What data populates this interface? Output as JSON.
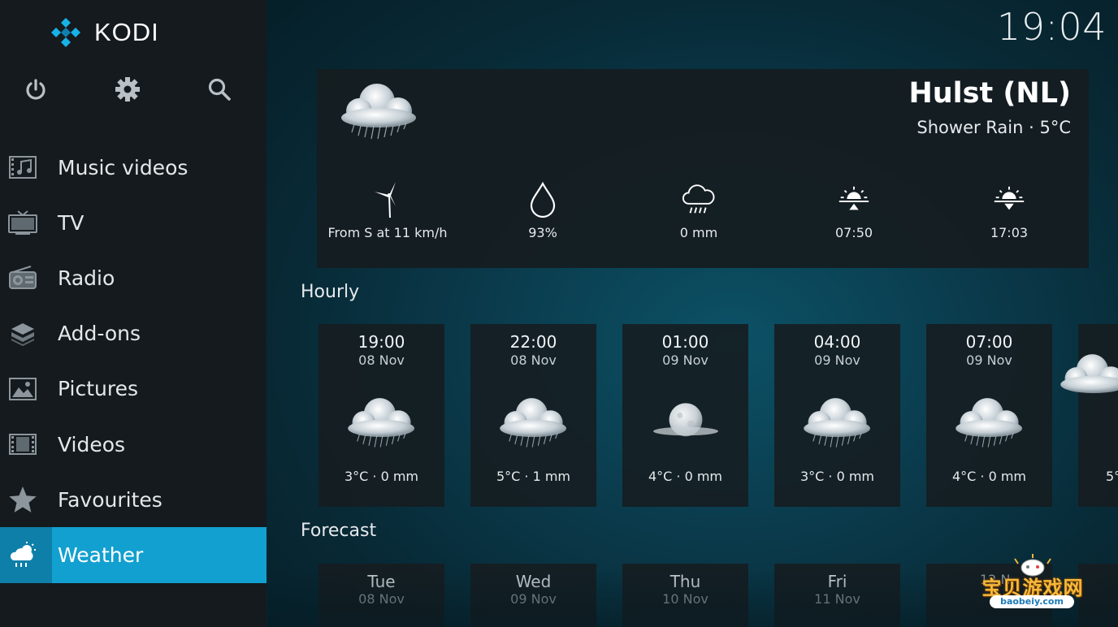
{
  "app": {
    "logo_text": "KODI"
  },
  "clock": "19:04",
  "sidebar": {
    "top_icons": [
      "power-icon",
      "settings-icon",
      "search-icon"
    ],
    "items": [
      {
        "label": "Music videos",
        "icon": "music-video-icon"
      },
      {
        "label": "TV",
        "icon": "tv-icon"
      },
      {
        "label": "Radio",
        "icon": "radio-icon"
      },
      {
        "label": "Add-ons",
        "icon": "addons-icon"
      },
      {
        "label": "Pictures",
        "icon": "pictures-icon"
      },
      {
        "label": "Videos",
        "icon": "videos-icon"
      },
      {
        "label": "Favourites",
        "icon": "star-icon"
      },
      {
        "label": "Weather",
        "icon": "weather-icon",
        "active": true
      }
    ]
  },
  "current": {
    "city": "Hulst (NL)",
    "condition": "Shower Rain · 5°C",
    "wind": "From S at 11 km/h",
    "humidity": "93%",
    "precipitation": "0 mm",
    "sunrise": "07:50",
    "sunset": "17:03"
  },
  "sections": {
    "hourly": "Hourly",
    "forecast": "Forecast"
  },
  "hourly": [
    {
      "time": "19:00",
      "date": "08 Nov",
      "temp": "3°C · 0 mm",
      "icon": "cloud-rain-icon"
    },
    {
      "time": "22:00",
      "date": "08 Nov",
      "temp": "5°C · 1 mm",
      "icon": "cloud-rain-icon"
    },
    {
      "time": "01:00",
      "date": "09 Nov",
      "temp": "4°C · 0 mm",
      "icon": "moon-cloud-icon"
    },
    {
      "time": "04:00",
      "date": "09 Nov",
      "temp": "3°C · 0 mm",
      "icon": "cloud-rain-icon"
    },
    {
      "time": "07:00",
      "date": "09 Nov",
      "temp": "4°C · 0 mm",
      "icon": "cloud-rain-icon"
    },
    {
      "time": "",
      "date": "",
      "temp": "5°",
      "icon": "cloud-rain-icon"
    }
  ],
  "forecast": [
    {
      "day": "Tue",
      "date": "08 Nov"
    },
    {
      "day": "Wed",
      "date": "09 Nov"
    },
    {
      "day": "Thu",
      "date": "10 Nov"
    },
    {
      "day": "Fri",
      "date": "11 Nov"
    },
    {
      "day": "",
      "date": "12 N"
    }
  ],
  "watermark": {
    "text": "宝贝游戏网",
    "url": "baobeiy.com"
  }
}
